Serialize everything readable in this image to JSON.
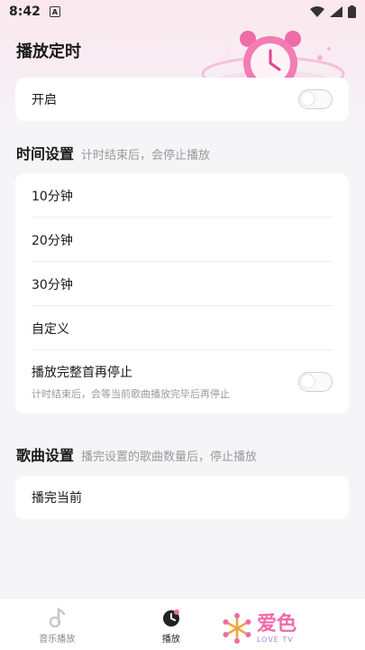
{
  "status_bar": {
    "time": "8:42",
    "app_badge": "A"
  },
  "header": {
    "title": "播放定时"
  },
  "enable_card": {
    "label": "开启",
    "enabled": false
  },
  "time_section": {
    "title": "时间设置",
    "subtitle": "计时结束后，会停止播放",
    "options": [
      {
        "label": "10分钟"
      },
      {
        "label": "20分钟"
      },
      {
        "label": "30分钟"
      },
      {
        "label": "自定义"
      }
    ],
    "finish_option": {
      "label": "播放完整首再停止",
      "description": "计时结束后，会等当前歌曲播放完毕后再停止",
      "enabled": false
    }
  },
  "song_section": {
    "title": "歌曲设置",
    "subtitle": "播完设置的歌曲数量后，停止播放",
    "options": [
      {
        "label": "播完当前"
      }
    ]
  },
  "bottom_nav": {
    "items": [
      {
        "label": "音乐播放",
        "icon": "music-note-icon"
      },
      {
        "label": "播放",
        "icon": "timer-icon",
        "active": true
      }
    ]
  },
  "watermark": {
    "main": "爱色",
    "sub": "LOVE TV"
  },
  "colors": {
    "accent": "#f06ba8",
    "background": "#f5f5f7"
  }
}
